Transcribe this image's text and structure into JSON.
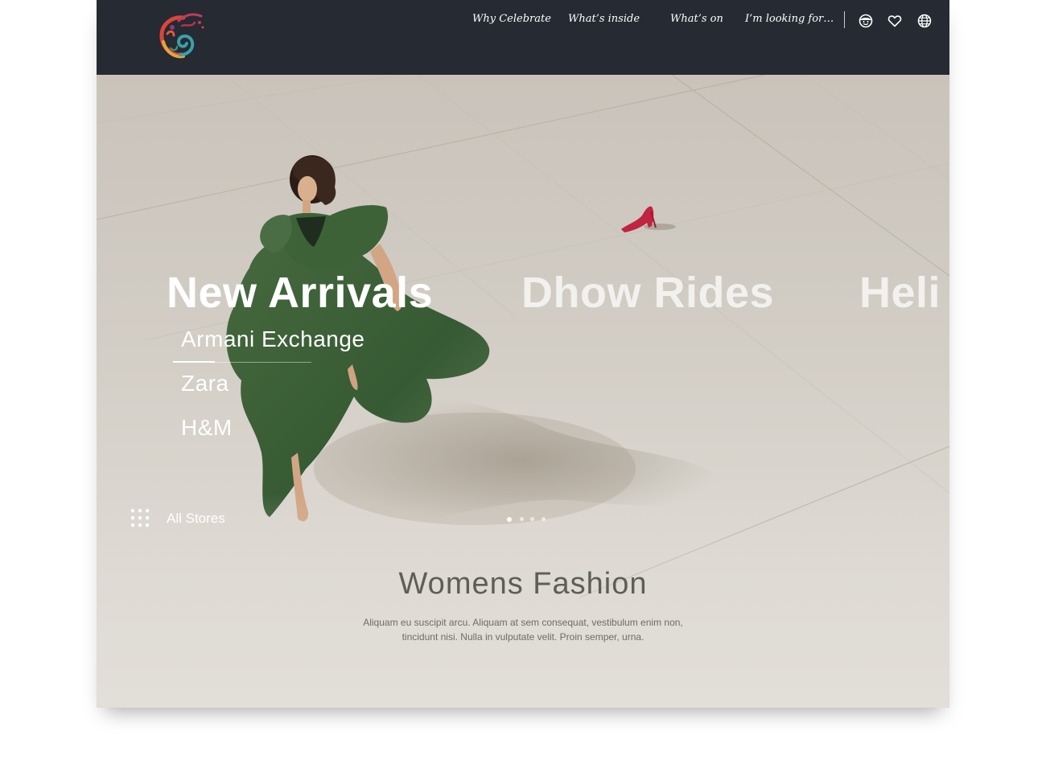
{
  "nav": {
    "links": [
      {
        "label": "Why Celebrate"
      },
      {
        "label": "What’s  inside"
      },
      {
        "label": "What’s on"
      },
      {
        "label": "I’m looking for…"
      }
    ],
    "icons": [
      "face-icon",
      "heart-icon",
      "globe-icon"
    ]
  },
  "hero": {
    "categories": [
      {
        "label": "New Arrivals",
        "active": true
      },
      {
        "label": "Dhow Rides",
        "active": false
      },
      {
        "label": "Heli",
        "active": false
      }
    ],
    "stores": [
      {
        "label": "Armani Exchange",
        "selected": true
      },
      {
        "label": "Zara"
      },
      {
        "label": "H&M"
      }
    ],
    "all_stores_label": "All Stores",
    "slides": {
      "count": 4,
      "active_index": 0
    }
  },
  "section": {
    "title": "Womens Fashion",
    "description": "Aliquam eu suscipit arcu. Aliquam at sem consequat, vestibulum enim non, tincidunt nisi. Nulla in vulputate velit. Proin semper, urna."
  },
  "colors": {
    "navbar_bg": "#252a33",
    "dress_green": "#3f5f3a",
    "shoe_red": "#c0243f",
    "heading_gray": "#5f5d57"
  }
}
